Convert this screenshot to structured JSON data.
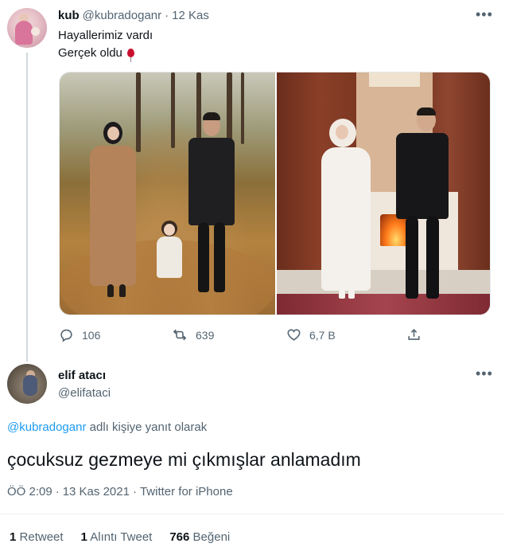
{
  "tweet": {
    "display_name": "kub",
    "handle": "@kubradoganr",
    "separator": "·",
    "date": "12 Kas",
    "text_line1": "Hayallerimiz vardı",
    "text_line2": "Gerçek oldu",
    "emoji_icon": "balloon-icon",
    "actions": {
      "reply_count": "106",
      "retweet_count": "639",
      "like_count": "6,7 B"
    }
  },
  "reply": {
    "display_name": "elif atacı",
    "handle": "@elifataci",
    "replying_mention": "@kubradoganr",
    "replying_suffix": " adlı kişiye yanıt olarak",
    "text": "çocuksuz gezmeye mi çıkmışlar anlamadım",
    "time": "ÖÖ 2:09",
    "date": "13 Kas 2021",
    "source": "Twitter for iPhone",
    "separator": "·",
    "stats": {
      "retweets_count": "1",
      "retweets_label": "Retweet",
      "quotes_count": "1",
      "quotes_label": "Alıntı Tweet",
      "likes_count": "766",
      "likes_label": "Beğeni"
    }
  },
  "colors": {
    "accent": "#1d9bf0",
    "muted": "#536471",
    "text": "#0f1419"
  }
}
